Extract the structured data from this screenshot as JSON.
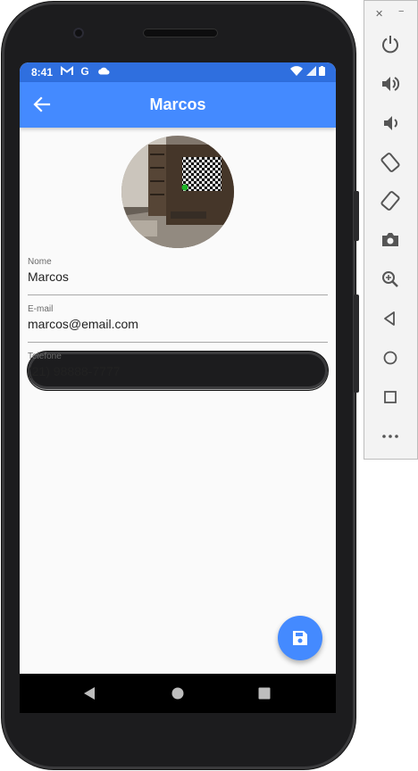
{
  "status_bar": {
    "time": "8:41",
    "left_icons": [
      "gmail-icon",
      "google-icon",
      "cloud-icon"
    ],
    "right_icons": [
      "wifi-icon",
      "signal-icon",
      "battery-icon"
    ]
  },
  "app_bar": {
    "title": "Marcos",
    "color": "#448aff"
  },
  "contact": {
    "avatar": "room-photo-avatar",
    "fields": [
      {
        "label": "Nome",
        "value": "Marcos"
      },
      {
        "label": "E-mail",
        "value": "marcos@email.com"
      },
      {
        "label": "Telefone",
        "value": "(21) 98888-7777"
      }
    ]
  },
  "fab": {
    "icon": "save-icon",
    "color": "#448aff"
  },
  "nav_bar": {
    "buttons": [
      "back-triangle-icon",
      "home-circle-icon",
      "recents-square-icon"
    ]
  },
  "emulator_panel": {
    "controls": [
      "close",
      "minimize",
      "power",
      "volume-up",
      "volume-down",
      "rotate-left",
      "rotate-right",
      "screenshot",
      "zoom",
      "back",
      "home",
      "overview",
      "more"
    ],
    "close_glyph": "✕",
    "minimize_glyph": "−"
  }
}
